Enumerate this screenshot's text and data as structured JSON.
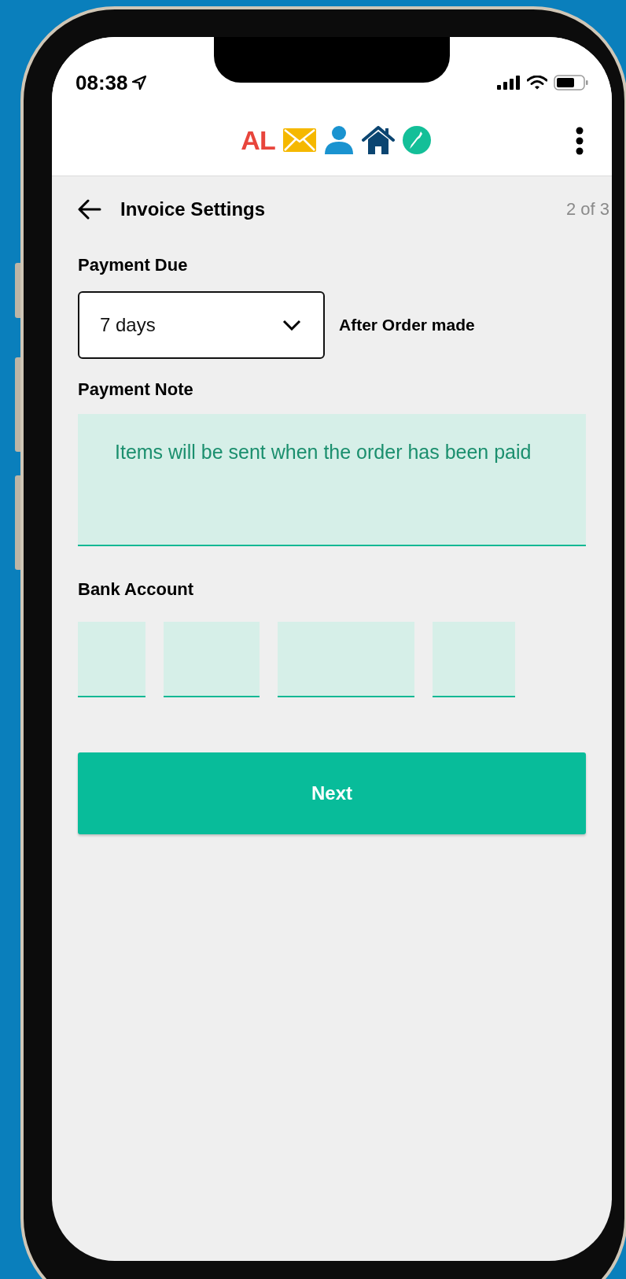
{
  "status_bar": {
    "time": "08:38"
  },
  "header": {
    "logo_text": "AL"
  },
  "page": {
    "title": "Invoice Settings",
    "step": "2 of 3"
  },
  "payment_due": {
    "label": "Payment Due",
    "value": "7 days",
    "suffix": "After Order made"
  },
  "payment_note": {
    "label": "Payment Note",
    "value": "Items will be sent when the order has been paid"
  },
  "bank_account": {
    "label": "Bank Account"
  },
  "buttons": [
    "Next"
  ]
}
